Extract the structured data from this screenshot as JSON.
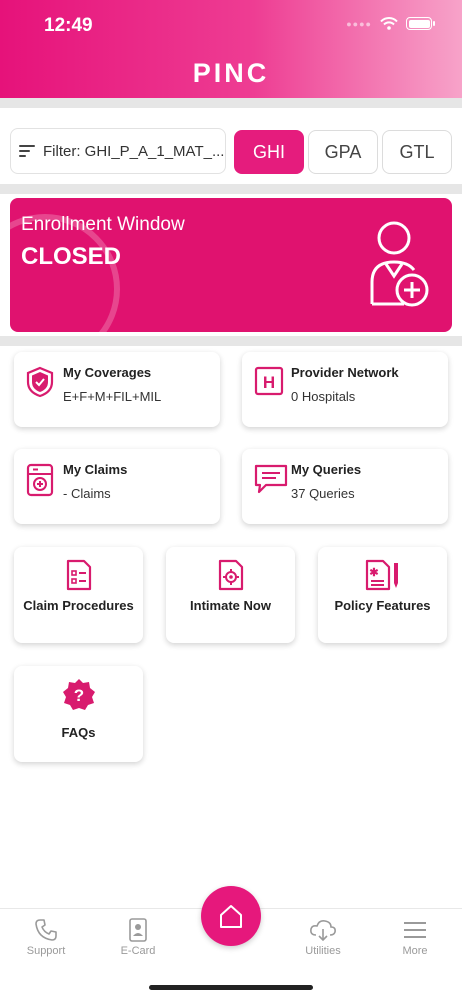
{
  "status_bar": {
    "time": "12:49"
  },
  "brand": {
    "logo": "PINC",
    "color": "#e51c7d"
  },
  "filter": {
    "label": "Filter: GHI_P_A_1_MAT_..."
  },
  "tabs": [
    {
      "label": "GHI",
      "active": true
    },
    {
      "label": "GPA",
      "active": false
    },
    {
      "label": "GTL",
      "active": false
    }
  ],
  "enrollment": {
    "title": "Enrollment Window",
    "status": "CLOSED"
  },
  "cards": {
    "coverages": {
      "title": "My Coverages",
      "value": "E+F+M+FIL+MIL",
      "icon": "shield-check-icon"
    },
    "provider": {
      "title": "Provider Network",
      "value": "0 Hospitals",
      "icon": "hospital-icon"
    },
    "claims": {
      "title": "My Claims",
      "value": "- Claims",
      "icon": "claim-box-icon"
    },
    "queries": {
      "title": "My Queries",
      "value": "37 Queries",
      "icon": "chat-icon"
    }
  },
  "tiles": {
    "claim_procedures": {
      "label": "Claim Procedures",
      "icon": "checklist-document-icon"
    },
    "intimate_now": {
      "label": "Intimate Now",
      "icon": "gear-document-icon"
    },
    "policy_features": {
      "label": "Policy Features",
      "icon": "document-pen-icon"
    },
    "faqs": {
      "label": "FAQs",
      "icon": "question-badge-icon"
    }
  },
  "bottom_nav": {
    "support": "Support",
    "ecard": "E-Card",
    "utilities": "Utilities",
    "more": "More"
  }
}
